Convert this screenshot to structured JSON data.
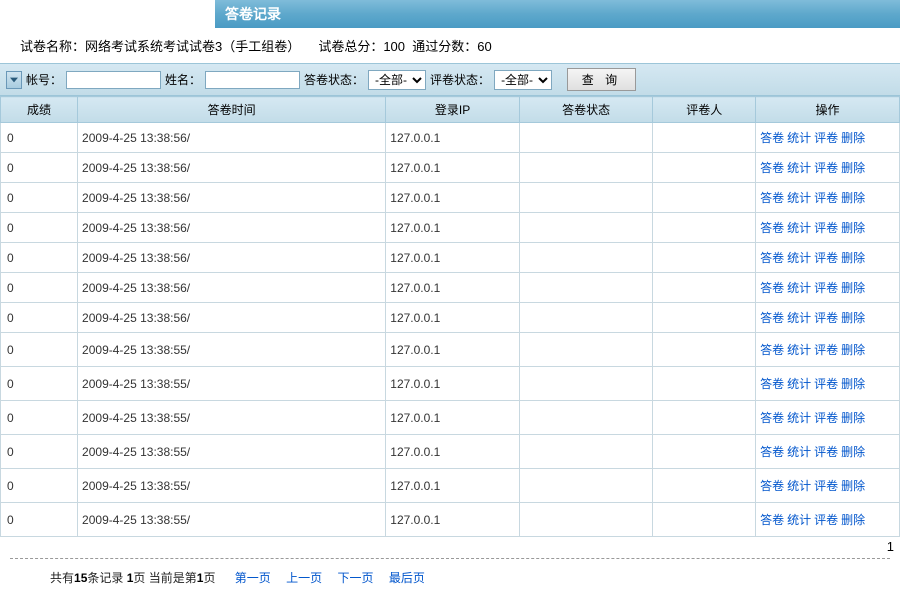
{
  "titleBar": {
    "title": "答卷记录"
  },
  "info": {
    "paperLabel": "试卷名称：",
    "paperName": "网络考试系统考试试卷3（手工组卷）",
    "totalLabel": "试卷总分：",
    "total": "100",
    "passLabel": "通过分数：",
    "pass": "60"
  },
  "filter": {
    "accountLabel": "帐号：",
    "nameLabel": "姓名：",
    "answerStatusLabel": "答卷状态：",
    "gradeStatusLabel": "评卷状态：",
    "allOption": "-全部-",
    "queryBtn": "查 询"
  },
  "columns": {
    "score": "成绩",
    "time": "答卷时间",
    "ip": "登录IP",
    "status": "答卷状态",
    "grader": "评卷人",
    "op": "操作"
  },
  "ops": {
    "answer": "答卷",
    "stat": "统计",
    "grade": "评卷",
    "del": "删除"
  },
  "rows": [
    {
      "score": "0",
      "time": "2009-4-25 13:38:56/",
      "ip": "127.0.0.1",
      "status": "",
      "grader": ""
    },
    {
      "score": "0",
      "time": "2009-4-25 13:38:56/",
      "ip": "127.0.0.1",
      "status": "",
      "grader": ""
    },
    {
      "score": "0",
      "time": "2009-4-25 13:38:56/",
      "ip": "127.0.0.1",
      "status": "",
      "grader": ""
    },
    {
      "score": "0",
      "time": "2009-4-25 13:38:56/",
      "ip": "127.0.0.1",
      "status": "",
      "grader": ""
    },
    {
      "score": "0",
      "time": "2009-4-25 13:38:56/",
      "ip": "127.0.0.1",
      "status": "",
      "grader": ""
    },
    {
      "score": "0",
      "time": "2009-4-25 13:38:56/",
      "ip": "127.0.0.1",
      "status": "",
      "grader": ""
    },
    {
      "score": "0",
      "time": "2009-4-25 13:38:56/",
      "ip": "127.0.0.1",
      "status": "",
      "grader": ""
    },
    {
      "score": "0",
      "time": "2009-4-25 13:38:55/",
      "ip": "127.0.0.1",
      "status": "",
      "grader": ""
    },
    {
      "score": "0",
      "time": "2009-4-25 13:38:55/",
      "ip": "127.0.0.1",
      "status": "",
      "grader": ""
    },
    {
      "score": "0",
      "time": "2009-4-25 13:38:55/",
      "ip": "127.0.0.1",
      "status": "",
      "grader": ""
    },
    {
      "score": "0",
      "time": "2009-4-25 13:38:55/",
      "ip": "127.0.0.1",
      "status": "",
      "grader": ""
    },
    {
      "score": "0",
      "time": "2009-4-25 13:38:55/",
      "ip": "127.0.0.1",
      "status": "",
      "grader": ""
    },
    {
      "score": "0",
      "time": "2009-4-25 13:38:55/",
      "ip": "127.0.0.1",
      "status": "",
      "grader": ""
    }
  ],
  "pager": {
    "rightNum": "1",
    "prefix": "共有",
    "count": "15",
    "mid1": "条记录 ",
    "pages": "1",
    "mid2": "页 当前是第",
    "cur": "1",
    "mid3": "页",
    "first": "第一页",
    "prev": "上一页",
    "next": "下一页",
    "last": "最后页"
  }
}
